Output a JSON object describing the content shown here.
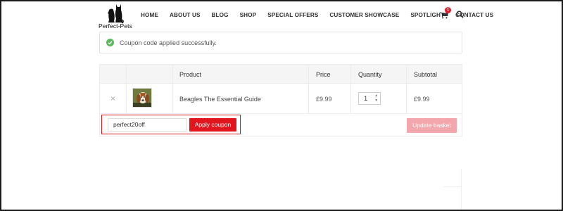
{
  "brand": {
    "name": "Perfect-Pets"
  },
  "nav": {
    "items": [
      "HOME",
      "ABOUT US",
      "BLOG",
      "SHOP",
      "SPECIAL OFFERS",
      "CUSTOMER SHOWCASE",
      "SPOTLIGHT",
      "CONTACT US"
    ],
    "cart_count": "1",
    "icons": {
      "cart": "cart-icon",
      "search": "search-icon"
    }
  },
  "notice": {
    "text": "Coupon code applied successfully.",
    "icon": "check-circle-icon",
    "color": "#5cb85c"
  },
  "cart": {
    "headers": {
      "product": "Product",
      "price": "Price",
      "quantity": "Quantity",
      "subtotal": "Subtotal"
    },
    "items": [
      {
        "name": "Beagles The Essential Guide",
        "price": "£9.99",
        "quantity": "1",
        "subtotal": "£9.99"
      }
    ],
    "coupon": {
      "value": "perfect20off",
      "apply_label": "Apply coupon"
    },
    "update_label": "Update basket"
  },
  "colors": {
    "accent": "#e0151e",
    "accent_disabled": "#f3a6ab",
    "badge": "#e11d2a"
  }
}
